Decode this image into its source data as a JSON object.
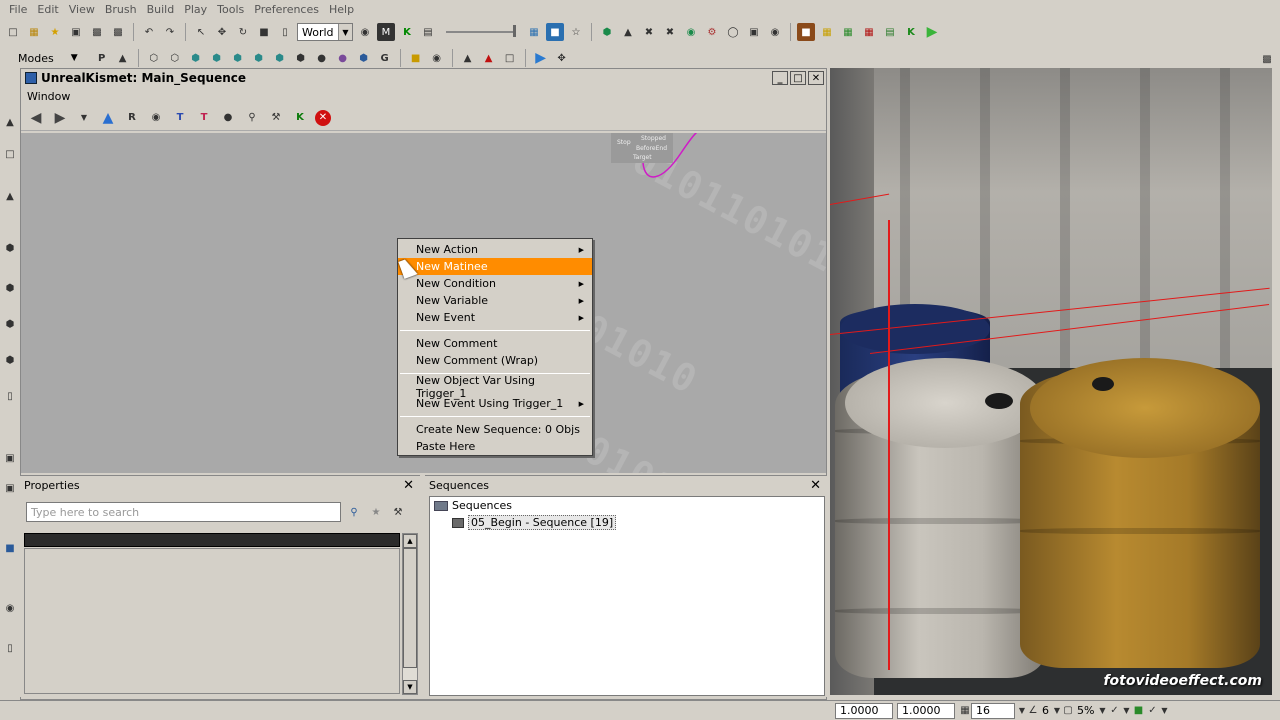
{
  "menubar": [
    "File",
    "Edit",
    "View",
    "Brush",
    "Build",
    "Play",
    "Tools",
    "Preferences",
    "Help"
  ],
  "toolbar": {
    "coordinate_system": "World"
  },
  "modes": {
    "label": "Modes"
  },
  "kismet": {
    "title": "UnrealKismet: Main_Sequence",
    "menu": [
      "Window"
    ],
    "node": {
      "labels": [
        "Stop",
        "Stopped",
        "BeforeEnd",
        "Target"
      ]
    },
    "binary_text": [
      "0101101010",
      "0101101010",
      "1010110101"
    ],
    "context_menu": [
      {
        "label": "New Action",
        "submenu": true
      },
      {
        "label": "New Matinee",
        "submenu": false,
        "highlighted": true
      },
      {
        "label": "New Condition",
        "submenu": true
      },
      {
        "label": "New Variable",
        "submenu": true
      },
      {
        "label": "New Event",
        "submenu": true
      },
      {
        "separator": true
      },
      {
        "label": "New Comment",
        "submenu": false
      },
      {
        "label": "New Comment (Wrap)",
        "submenu": false
      },
      {
        "separator": true
      },
      {
        "label": "New Object Var Using Trigger_1",
        "submenu": false
      },
      {
        "label": "New Event Using Trigger_1",
        "submenu": true
      },
      {
        "separator": true
      },
      {
        "label": "Create New Sequence: 0 Objs",
        "submenu": false
      },
      {
        "label": "Paste Here",
        "submenu": false
      }
    ]
  },
  "properties": {
    "title": "Properties",
    "search_placeholder": "Type here to search"
  },
  "sequences": {
    "title": "Sequences",
    "root": "Sequences",
    "child": "05_Begin - Sequence [19]"
  },
  "viewport": {
    "watermark": "fotovideoeffect.com"
  },
  "statusbar": {
    "field1": "1.0000",
    "field2": "1.0000",
    "grid": "16",
    "angle": "6",
    "scale": "5%"
  }
}
